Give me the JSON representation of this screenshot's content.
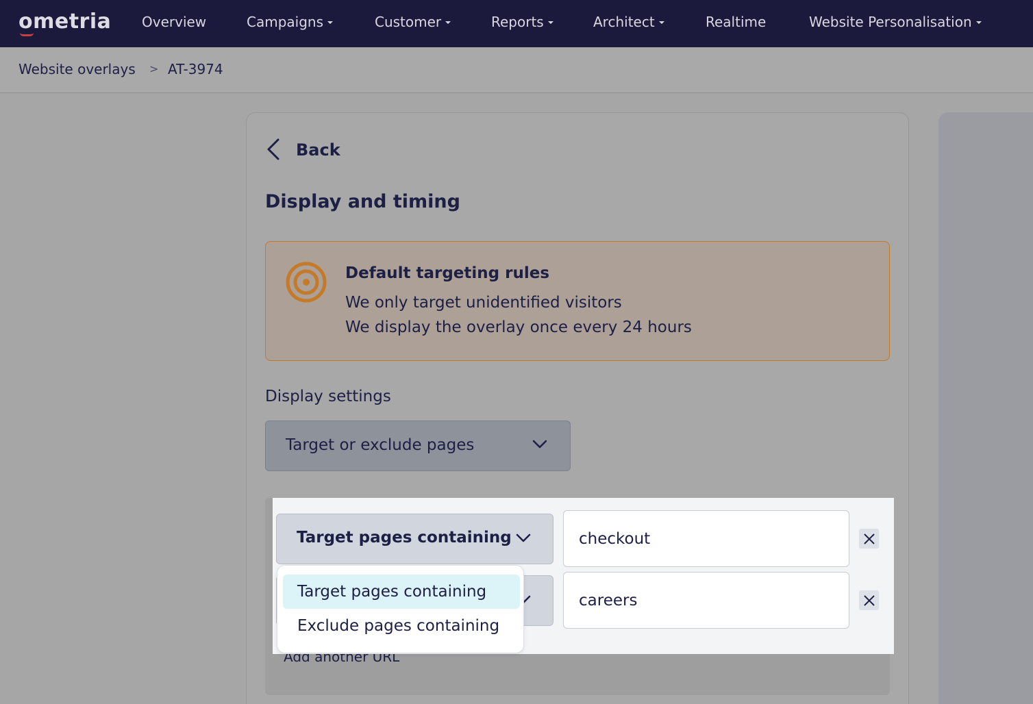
{
  "nav": {
    "logo": "ometria",
    "items": [
      {
        "label": "Overview",
        "dropdown": false
      },
      {
        "label": "Campaigns",
        "dropdown": true
      },
      {
        "label": "Customer",
        "dropdown": true
      },
      {
        "label": "Reports",
        "dropdown": true
      },
      {
        "label": "Architect",
        "dropdown": true
      },
      {
        "label": "Realtime",
        "dropdown": false
      },
      {
        "label": "Website Personalisation",
        "dropdown": true
      }
    ]
  },
  "breadcrumb": {
    "parent": "Website overlays",
    "separator": ">",
    "current": "AT-3974"
  },
  "page": {
    "back_label": "Back",
    "title": "Display and timing"
  },
  "notice": {
    "icon": "target-icon",
    "title": "Default targeting rules",
    "lines": [
      "We only target unidentified visitors",
      "We display the overlay once every 24 hours"
    ]
  },
  "display_settings": {
    "label": "Display settings",
    "selected": "Target or exclude pages"
  },
  "rules": {
    "rows": [
      {
        "mode": "Target pages containing",
        "url": "checkout"
      },
      {
        "mode": "",
        "url": "careers"
      }
    ],
    "add_url_label": "Add another URL",
    "dropdown_options": [
      {
        "label": "Target pages containing",
        "selected": true
      },
      {
        "label": "Exclude pages containing",
        "selected": false
      }
    ]
  },
  "colors": {
    "nav_bg": "#1b1a3c",
    "notice_border": "#c47a29",
    "target_icon": "#c47a29",
    "menu_active": "#dcf4f8"
  }
}
